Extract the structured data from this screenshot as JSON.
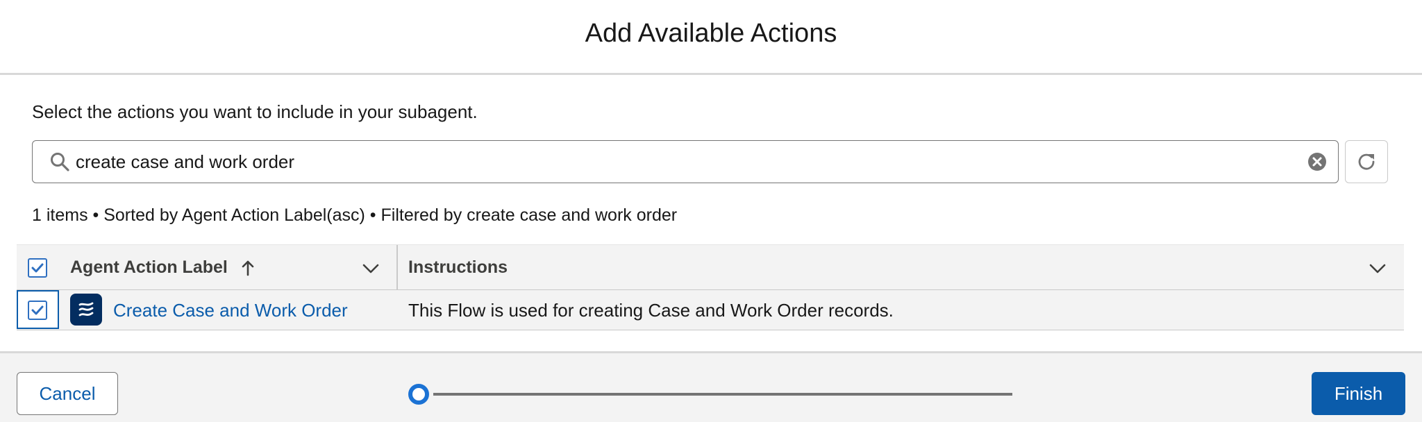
{
  "modal": {
    "title": "Add Available Actions",
    "instructions": "Select the actions you want to include in your subagent."
  },
  "search": {
    "value": "create case and work order",
    "placeholder": ""
  },
  "list": {
    "summary": "1 items • Sorted by Agent Action Label(asc) • Filtered by create case and work order",
    "columns": [
      {
        "label": "Agent Action Label",
        "sort": "asc"
      },
      {
        "label": "Instructions"
      }
    ],
    "select_all_checked": true,
    "rows": [
      {
        "checked": true,
        "icon": "flow-icon",
        "label": "Create Case and Work Order",
        "instructions": "This Flow is used for creating Case and Work Order records."
      }
    ]
  },
  "footer": {
    "cancel_label": "Cancel",
    "finish_label": "Finish",
    "progress": {
      "current_step": 1,
      "fraction": 0
    }
  },
  "colors": {
    "brand": "#0b5cab",
    "progress_step": "#1b72d4",
    "flow_icon_bg": "#032d60",
    "surface": "#f3f3f3"
  }
}
